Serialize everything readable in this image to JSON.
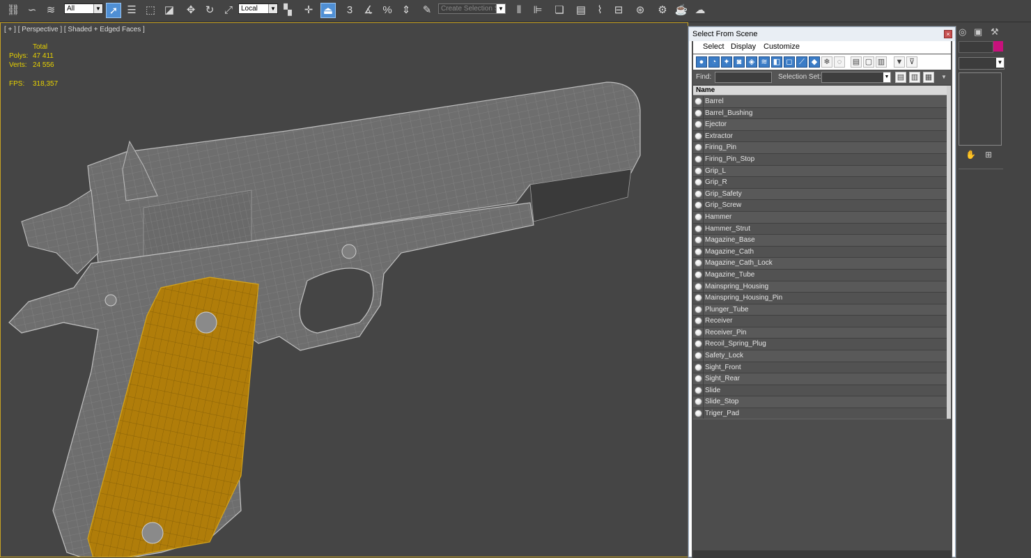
{
  "toolbar": {
    "filter_combo": "All",
    "coord_combo": "Local",
    "selection_set_combo": "Create Selection Se",
    "snap_label_angle": "3",
    "snap_label_percent": "%",
    "icons": [
      "link-icon",
      "unlink-icon",
      "bind-spacewarp-icon",
      "select-filter-combo",
      "select-object-icon",
      "select-by-name-icon",
      "rect-region-icon",
      "window-crossing-icon",
      "move-icon",
      "rotate-icon",
      "scale-icon",
      "coord-combo",
      "select-manipulate-icon",
      "pivot-icon",
      "keyboard-shortcut-icon",
      "snaps-toggle-icon",
      "angle-snap-icon",
      "percent-snap-icon",
      "spinner-snap-icon",
      "edit-named-selection-icon",
      "selection-set-combo",
      "mirror-icon",
      "align-icon",
      "layer-manager-icon",
      "scene-explorer-icon",
      "curve-editor-icon",
      "schematic-view-icon",
      "material-editor-icon",
      "render-setup-icon",
      "rendered-frame-icon",
      "render-icon"
    ]
  },
  "viewport": {
    "label": "[ + ] [ Perspective ] [ Shaded + Edged Faces ]",
    "stats": {
      "total_label": "Total",
      "polys_label": "Polys:",
      "polys_value": "47 411",
      "verts_label": "Verts:",
      "verts_value": "24 556",
      "fps_label": "FPS:",
      "fps_value": "318,357"
    },
    "colors": {
      "border": "#c8a323",
      "stats_text": "#e8d200",
      "grip": "#b07d0a",
      "mesh": "#6f6f6f"
    }
  },
  "dialog": {
    "title": "Select From Scene",
    "close_glyph": "×",
    "menu": [
      "Select",
      "Display",
      "Customize"
    ],
    "find_label": "Find:",
    "find_value": "",
    "selection_set_label": "Selection Set:",
    "selection_set_value": "",
    "column_header": "Name",
    "objects": [
      "Barrel",
      "Barrel_Bushing",
      "Ejector",
      "Extractor",
      "Firing_Pin",
      "Firing_Pin_Stop",
      "Grip_L",
      "Grip_R",
      "Grip_Safety",
      "Grip_Screw",
      "Hammer",
      "Hammer_Strut",
      "Magazine_Base",
      "Magazine_Cath",
      "Magazine_Cath_Lock",
      "Magazine_Tube",
      "Mainspring_Housing",
      "Mainspring_Housing_Pin",
      "Plunger_Tube",
      "Receiver",
      "Receiver_Pin",
      "Recoil_Spring_Plug",
      "Safety_Lock",
      "Sight_Front",
      "Sight_Rear",
      "Slide",
      "Slide_Stop",
      "Triger_Pad"
    ]
  }
}
